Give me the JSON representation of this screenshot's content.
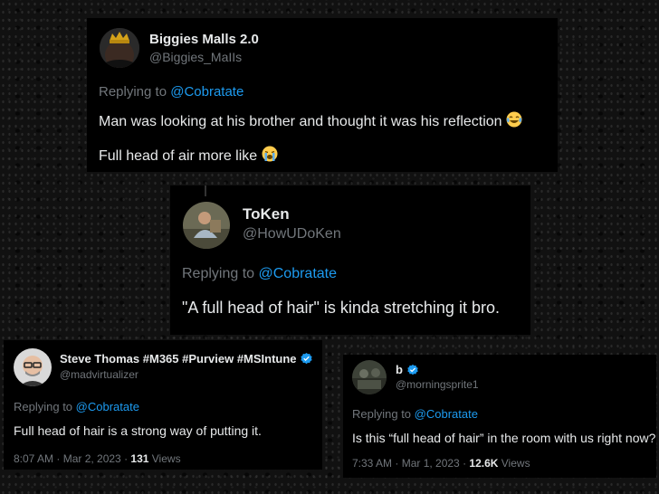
{
  "tweets": [
    {
      "name": "Biggies Malls 2.0",
      "handle": "@Biggies_MaIIs",
      "replying_prefix": "Replying to ",
      "replying_to": "@Cobratate",
      "lines": [
        "Man was looking at his brother and thought it was his reflection",
        "Full head of air more like"
      ]
    },
    {
      "name": "ToKen",
      "handle": "@HowUDoKen",
      "replying_prefix": "Replying to ",
      "replying_to": "@Cobratate",
      "lines": [
        "\"A full head of hair\" is kinda stretching it bro."
      ]
    },
    {
      "name": "Steve Thomas #M365 #Purview #MSIntune",
      "handle": "@madvirtualizer",
      "replying_prefix": "Replying to ",
      "replying_to": "@Cobratate",
      "lines": [
        "Full head of hair is a strong way of putting it."
      ],
      "timestamp": "8:07 AM · Mar 2, 2023 · ",
      "views_count": "131",
      "views_label": " Views"
    },
    {
      "name": "b",
      "handle": "@morningsprite1",
      "replying_prefix": "Replying to ",
      "replying_to": "@Cobratate",
      "lines": [
        "Is this “full head of hair” in the room with us right now?"
      ],
      "timestamp": "7:33 AM · Mar 1, 2023 · ",
      "views_count": "12.6K",
      "views_label": " Views"
    }
  ],
  "colors": {
    "mention": "#1d9bf0",
    "muted": "#71767b",
    "text": "#e7e9ea",
    "card": "#000000",
    "verified": "#1d9bf0"
  },
  "icons": [
    "laughing-crying-emoji",
    "loudly-crying-emoji",
    "verified-badge-icon"
  ]
}
